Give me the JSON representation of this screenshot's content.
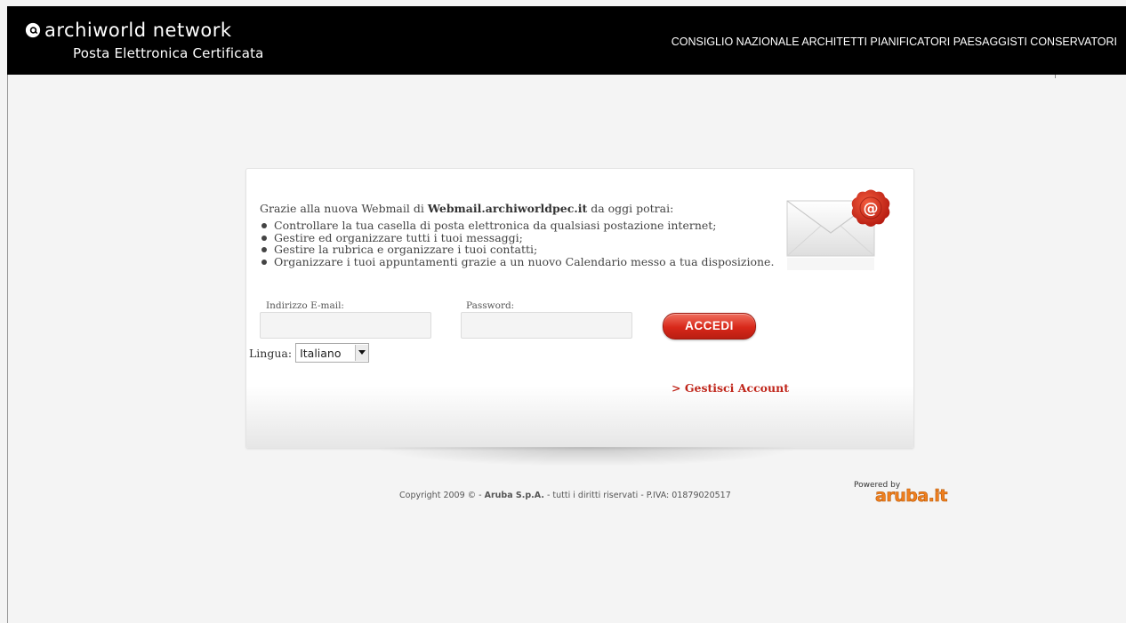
{
  "header": {
    "brand": "archiworld network",
    "subtitle": "Posta Elettronica Certificata",
    "organization": "CONSIGLIO NAZIONALE ARCHITETTI PIANIFICATORI PAESAGGISTI CONSERVATORI"
  },
  "intro": {
    "prefix": "Grazie alla nuova Webmail di ",
    "site": "Webmail.archiworldpec.it",
    "suffix": " da oggi potrai:"
  },
  "features": [
    "Controllare la tua casella di posta elettronica da qualsiasi postazione internet;",
    "Gestire ed organizzare tutti i tuoi messaggi;",
    "Gestire la rubrica e organizzare i tuoi contatti;",
    "Organizzare i tuoi appuntamenti grazie a un nuovo Calendario messo a tua disposizione."
  ],
  "login": {
    "email_label": "Indirizzo E-mail:",
    "email_value": "",
    "password_label": "Password:",
    "password_value": "",
    "submit_label": "ACCEDI",
    "language_label": "Lingua:",
    "language_selected": "Italiano",
    "manage_account_link": "> Gestisci Account"
  },
  "footer": {
    "copyright_prefix": "Copyright 2009 © - ",
    "company": "Aruba S.p.A.",
    "copyright_suffix": " - tutti i diritti riservati - P.IVA: 01879020517",
    "powered_by": "Powered by",
    "powered_logo": "aruba.it"
  },
  "icons": {
    "brand": "at-sign-icon",
    "envelope": "envelope-at-seal-icon",
    "dropdown": "chevron-down-icon"
  },
  "colors": {
    "header_bg": "#000000",
    "accent_red": "#c0271c",
    "aruba_orange": "#f07f1e"
  }
}
